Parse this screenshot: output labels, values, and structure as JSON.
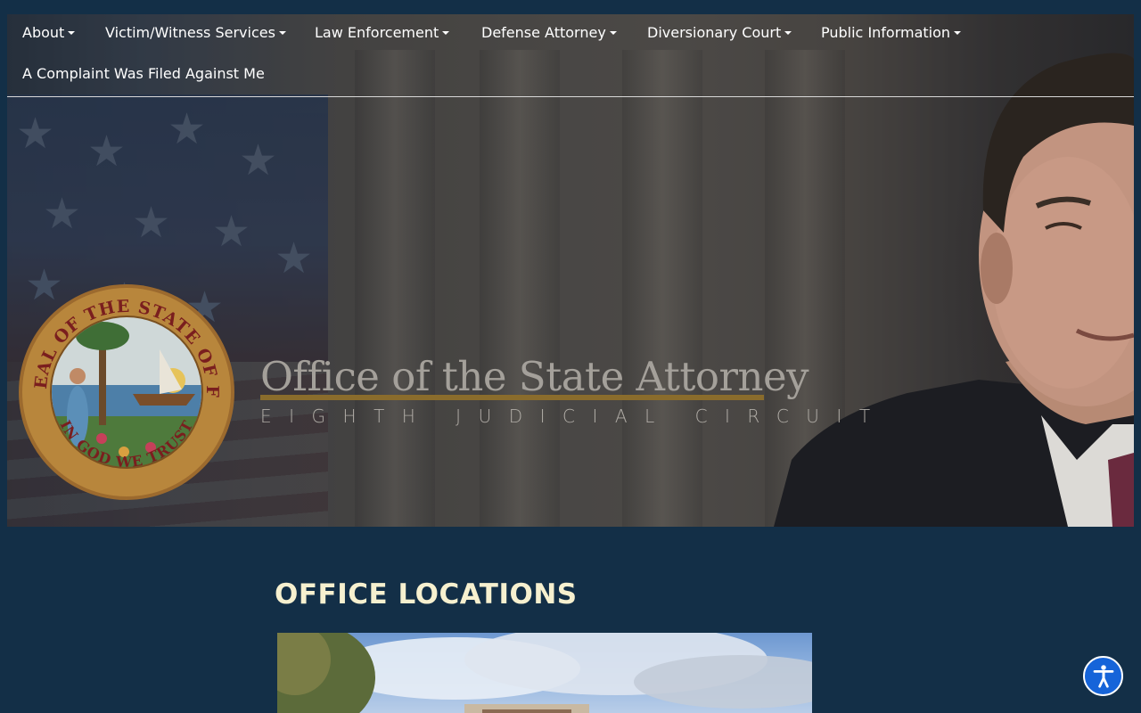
{
  "nav": {
    "items": [
      {
        "label": "About",
        "has_dropdown": true
      },
      {
        "label": "Victim/Witness Services",
        "has_dropdown": true
      },
      {
        "label": "Law Enforcement",
        "has_dropdown": true
      },
      {
        "label": "Defense Attorney",
        "has_dropdown": true
      },
      {
        "label": "Diversionary Court",
        "has_dropdown": true
      },
      {
        "label": "Public Information",
        "has_dropdown": true
      },
      {
        "label": "A Complaint Was Filed Against Me",
        "has_dropdown": false
      }
    ]
  },
  "hero": {
    "title": "Office of the State Attorney",
    "subtitle": "EIGHTH JUDICIAL CIRCUIT",
    "seal": {
      "top_text": "GREAT SEAL OF THE STATE OF FLORIDA",
      "bottom_text": "IN GOD WE TRUST"
    }
  },
  "main": {
    "heading": "OFFICE LOCATIONS"
  },
  "accessibility": {
    "icon": "accessibility-icon",
    "color": "#1664d9"
  },
  "colors": {
    "page_background": "#132f47",
    "heading": "#f6f0cf",
    "gold_accent": "#8a6c2c"
  }
}
